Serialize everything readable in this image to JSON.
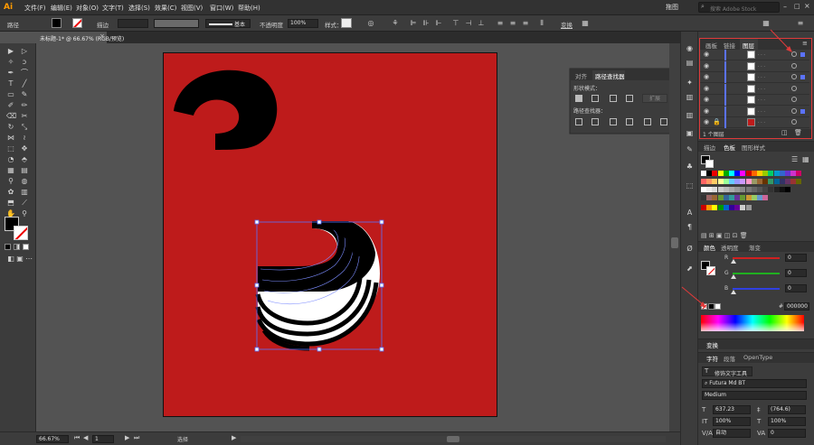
{
  "app": {
    "logo": "Ai",
    "workspace": "拖图",
    "search_placeholder": "搜索 Adobe Stock"
  },
  "menu": [
    "文件(F)",
    "编辑(E)",
    "对象(O)",
    "文字(T)",
    "选择(S)",
    "效果(C)",
    "视图(V)",
    "窗口(W)",
    "帮助(H)"
  ],
  "control": {
    "object_type": "路径",
    "stroke_label": "描边",
    "stroke_style": "基本",
    "opacity_label": "不透明度",
    "opacity_value": "100%",
    "style_label": "样式：",
    "transform_label": "变换"
  },
  "document_tab": {
    "title": "未标题-1* @ 66.67% (RGB/预览)",
    "close": "×"
  },
  "pathfinder": {
    "tabs": [
      "对齐",
      "路径查找器"
    ],
    "shape_modes_label": "形状模式：",
    "expand_label": "扩展",
    "pathfinders_label": "路径查找器："
  },
  "layers_panel": {
    "tabs": [
      "画板",
      "链接",
      "图层"
    ],
    "row_count": 7,
    "footer": "1 个图层"
  },
  "swatches_panel": {
    "tabs": [
      "描边",
      "色板",
      "图形样式"
    ]
  },
  "color_panel": {
    "tabs": [
      "颜色",
      "透明度",
      "渐变"
    ],
    "channels": [
      {
        "label": "R",
        "value": "0",
        "color": "#d02020"
      },
      {
        "label": "G",
        "value": "0",
        "color": "#20b020"
      },
      {
        "label": "B",
        "value": "0",
        "color": "#3040e0"
      }
    ],
    "hex_prefix": "#",
    "hex_value": "000000"
  },
  "transform_panel": {
    "title": "变换"
  },
  "character_panel": {
    "tabs": [
      "字符",
      "段落",
      "OpenType"
    ],
    "touch_type_button": "修饰文字工具",
    "font_family": "Futura Md BT",
    "font_style": "Medium",
    "font_size": "637.23",
    "leading": "(764.6)",
    "vertical_scale": "100%",
    "horizontal_scale": "100%",
    "kerning": "自动",
    "tracking": "0"
  },
  "status": {
    "zoom": "66.67%",
    "artboard": "1",
    "tool": "选择"
  },
  "colors": {
    "artboard": "#be1b1b",
    "highlight_box": "#e03a3a",
    "selection": "#5b72ff",
    "shape_fill": "#000000"
  },
  "icons": [
    "selection-tool-icon",
    "direct-selection-icon",
    "pen-icon",
    "type-icon",
    "rectangle-icon",
    "brush-icon",
    "eraser-icon",
    "rotate-icon",
    "scale-icon",
    "gradient-icon",
    "eyedropper-icon",
    "zoom-icon",
    "hand-icon",
    "eye-icon",
    "lock-icon"
  ]
}
